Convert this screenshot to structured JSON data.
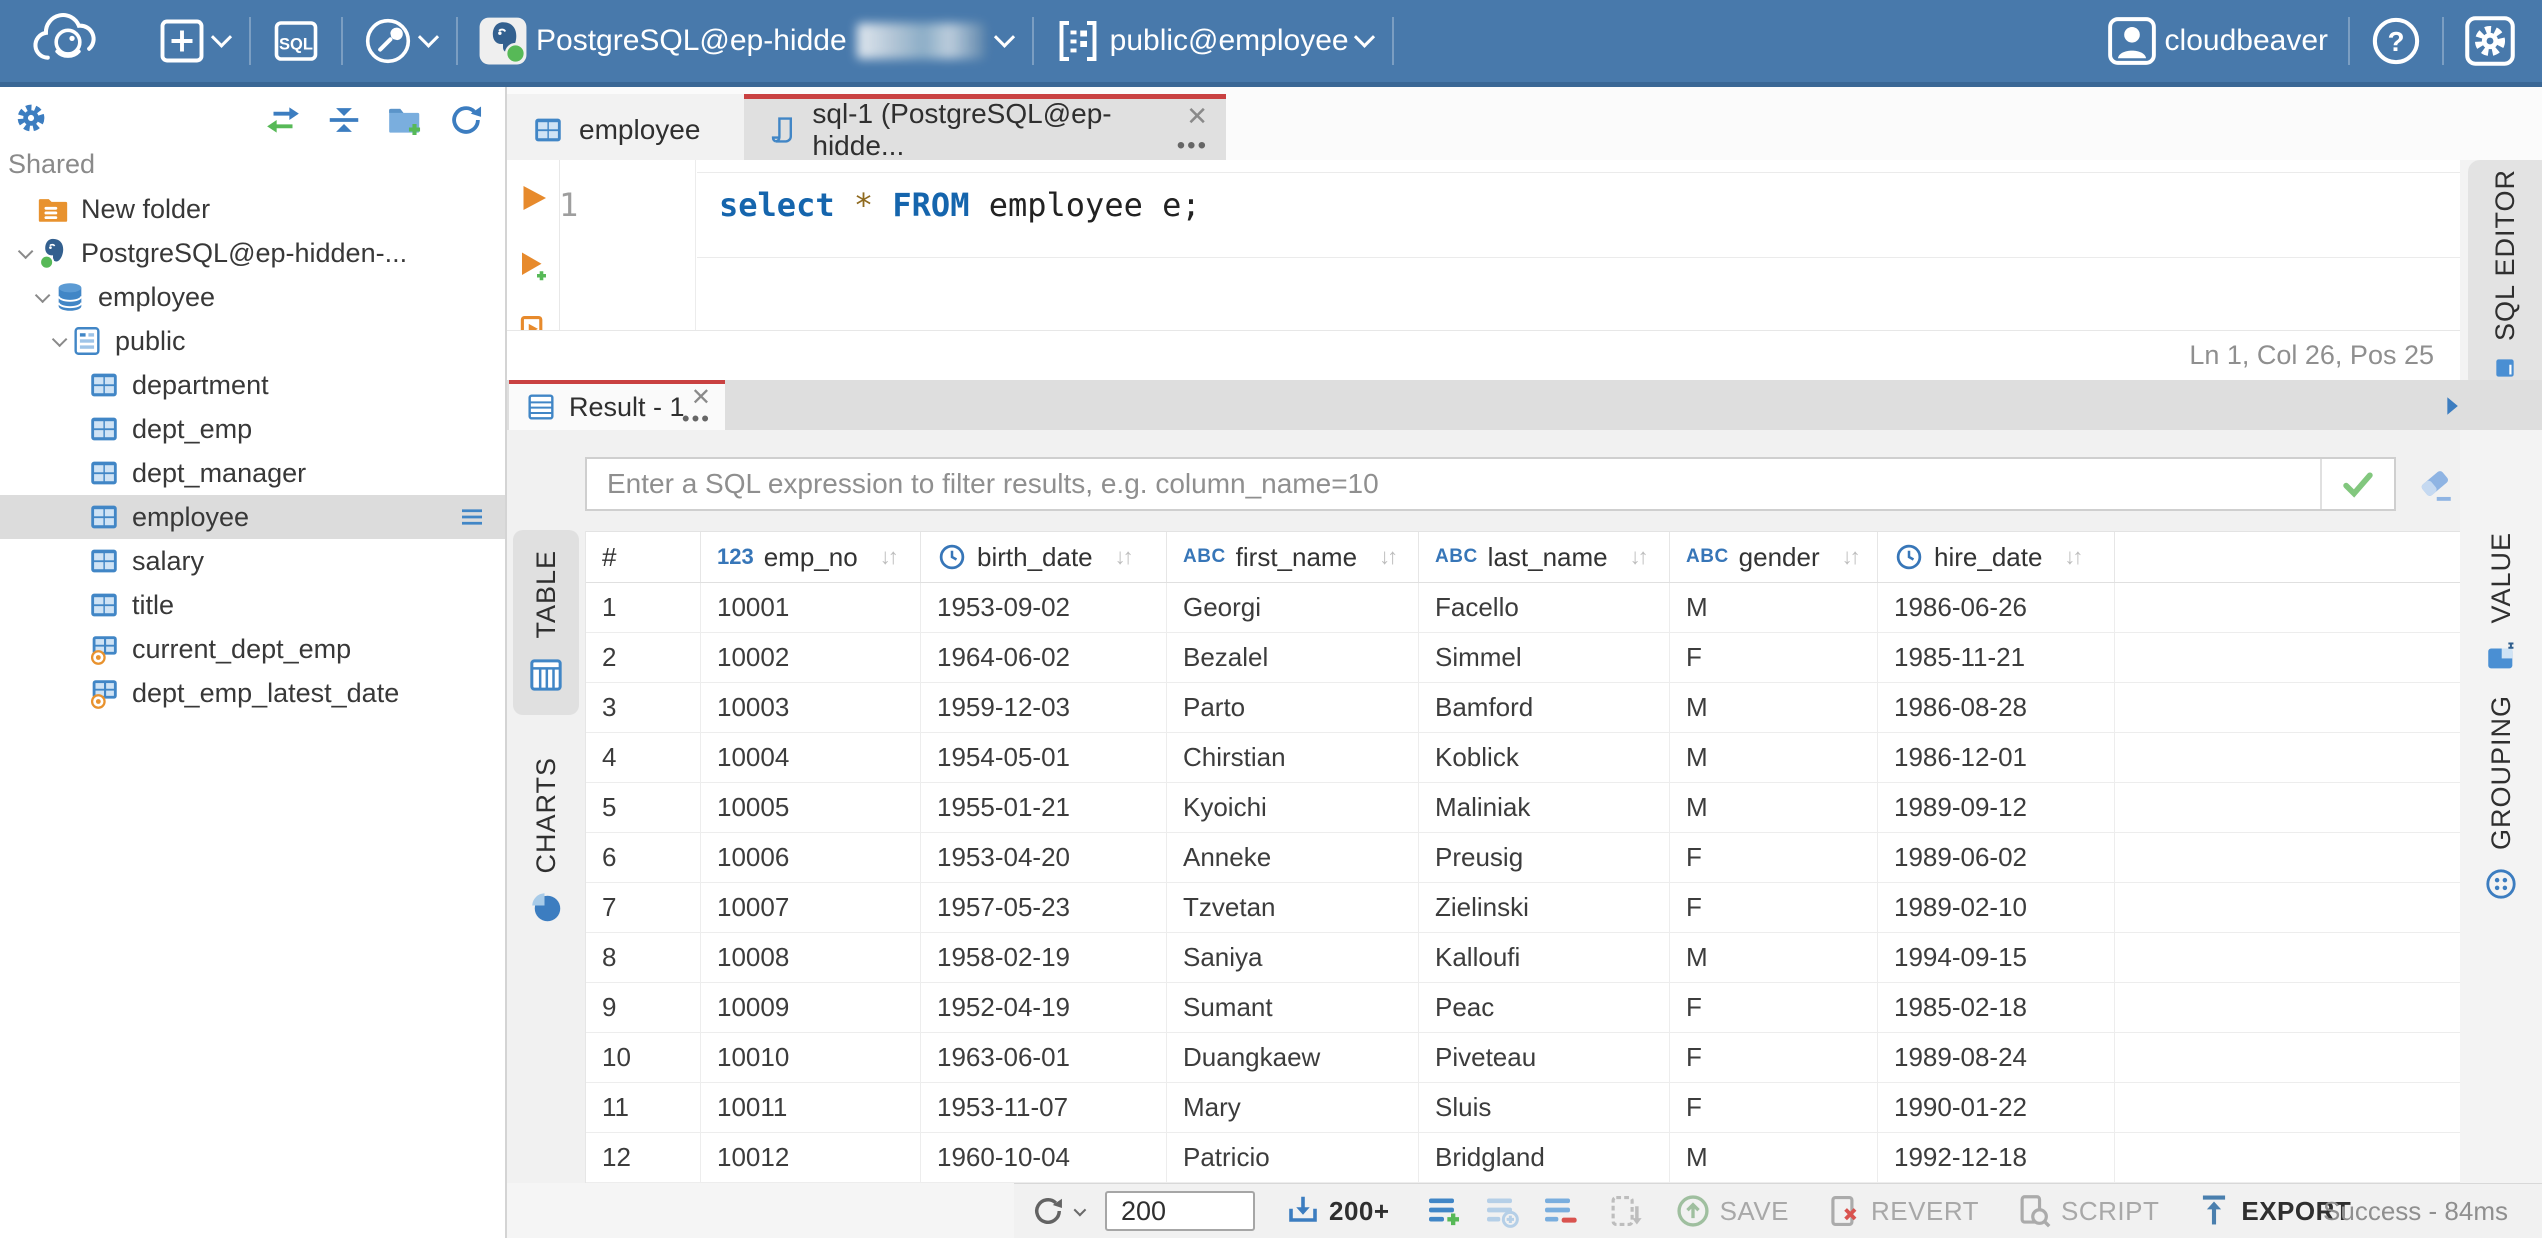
{
  "topbar": {
    "sql_button": "SQL",
    "connection_label": "PostgreSQL@ep-hidde",
    "schema_label": "public@employee",
    "user_label": "cloudbeaver"
  },
  "sidebar": {
    "section_label": "Shared",
    "tree": [
      {
        "label": "New folder",
        "icon": "folder-database-icon",
        "level": 0,
        "chevron": false,
        "selected": false
      },
      {
        "label": "PostgreSQL@ep-hidden-...",
        "icon": "postgresql-icon",
        "level": 0,
        "chevron": true,
        "selected": false
      },
      {
        "label": "employee",
        "icon": "database-icon",
        "level": 1,
        "chevron": true,
        "selected": false
      },
      {
        "label": "public",
        "icon": "schema-icon",
        "level": 2,
        "chevron": true,
        "selected": false
      },
      {
        "label": "department",
        "icon": "table-icon",
        "level": 3,
        "chevron": false,
        "selected": false
      },
      {
        "label": "dept_emp",
        "icon": "table-icon",
        "level": 3,
        "chevron": false,
        "selected": false
      },
      {
        "label": "dept_manager",
        "icon": "table-icon",
        "level": 3,
        "chevron": false,
        "selected": false
      },
      {
        "label": "employee",
        "icon": "table-icon",
        "level": 3,
        "chevron": false,
        "selected": true
      },
      {
        "label": "salary",
        "icon": "table-icon",
        "level": 3,
        "chevron": false,
        "selected": false
      },
      {
        "label": "title",
        "icon": "table-icon",
        "level": 3,
        "chevron": false,
        "selected": false
      },
      {
        "label": "current_dept_emp",
        "icon": "view-icon",
        "level": 3,
        "chevron": false,
        "selected": false
      },
      {
        "label": "dept_emp_latest_date",
        "icon": "view-icon",
        "level": 3,
        "chevron": false,
        "selected": false
      }
    ]
  },
  "tabs": {
    "editor_tabs": [
      {
        "label": "employee",
        "active": false
      },
      {
        "label": "sql-1 (PostgreSQL@ep-hidde...",
        "active": true
      }
    ],
    "right_panel_tabs": [
      "SQL EDITOR",
      "VALUE",
      "GROUPING"
    ],
    "result_side_tabs": [
      "TABLE",
      "CHARTS"
    ]
  },
  "editor": {
    "line_number": "1",
    "code_tokens": [
      {
        "text": "select",
        "type": "keyword"
      },
      {
        "text": " ",
        "type": "plain"
      },
      {
        "text": "*",
        "type": "star"
      },
      {
        "text": " ",
        "type": "plain"
      },
      {
        "text": "FROM",
        "type": "keyword"
      },
      {
        "text": " employee e;",
        "type": "plain"
      }
    ],
    "status": "Ln 1, Col 26, Pos 25"
  },
  "result": {
    "tab_label": "Result - 1",
    "filter_placeholder": "Enter a SQL expression to filter results, e.g. column_name=10",
    "columns": [
      {
        "name": "#",
        "type_icon": ""
      },
      {
        "name": "emp_no",
        "type_icon": "123"
      },
      {
        "name": "birth_date",
        "type_icon": "clock"
      },
      {
        "name": "first_name",
        "type_icon": "ABC"
      },
      {
        "name": "last_name",
        "type_icon": "ABC"
      },
      {
        "name": "gender",
        "type_icon": "ABC"
      },
      {
        "name": "hire_date",
        "type_icon": "clock"
      }
    ],
    "rows": [
      [
        "1",
        "10001",
        "1953-09-02",
        "Georgi",
        "Facello",
        "M",
        "1986-06-26"
      ],
      [
        "2",
        "10002",
        "1964-06-02",
        "Bezalel",
        "Simmel",
        "F",
        "1985-11-21"
      ],
      [
        "3",
        "10003",
        "1959-12-03",
        "Parto",
        "Bamford",
        "M",
        "1986-08-28"
      ],
      [
        "4",
        "10004",
        "1954-05-01",
        "Chirstian",
        "Koblick",
        "M",
        "1986-12-01"
      ],
      [
        "5",
        "10005",
        "1955-01-21",
        "Kyoichi",
        "Maliniak",
        "M",
        "1989-09-12"
      ],
      [
        "6",
        "10006",
        "1953-04-20",
        "Anneke",
        "Preusig",
        "F",
        "1989-06-02"
      ],
      [
        "7",
        "10007",
        "1957-05-23",
        "Tzvetan",
        "Zielinski",
        "F",
        "1989-02-10"
      ],
      [
        "8",
        "10008",
        "1958-02-19",
        "Saniya",
        "Kalloufi",
        "M",
        "1994-09-15"
      ],
      [
        "9",
        "10009",
        "1952-04-19",
        "Sumant",
        "Peac",
        "F",
        "1985-02-18"
      ],
      [
        "10",
        "10010",
        "1963-06-01",
        "Duangkaew",
        "Piveteau",
        "F",
        "1989-08-24"
      ],
      [
        "11",
        "10011",
        "1953-11-07",
        "Mary",
        "Sluis",
        "F",
        "1990-01-22"
      ],
      [
        "12",
        "10012",
        "1960-10-04",
        "Patricio",
        "Bridgland",
        "M",
        "1992-12-18"
      ]
    ]
  },
  "toolbar": {
    "fetch_size": "200",
    "fetch_more_label": "200+",
    "save_label": "SAVE",
    "revert_label": "REVERT",
    "script_label": "SCRIPT",
    "export_label": "EXPORT",
    "status": "Success - 84ms"
  },
  "colors": {
    "topbar": "#4879ab",
    "accent_red": "#c94141",
    "icon_blue": "#3c7dc0",
    "keyword_blue": "#1565ad",
    "selected_row": "#dcdcdc"
  }
}
